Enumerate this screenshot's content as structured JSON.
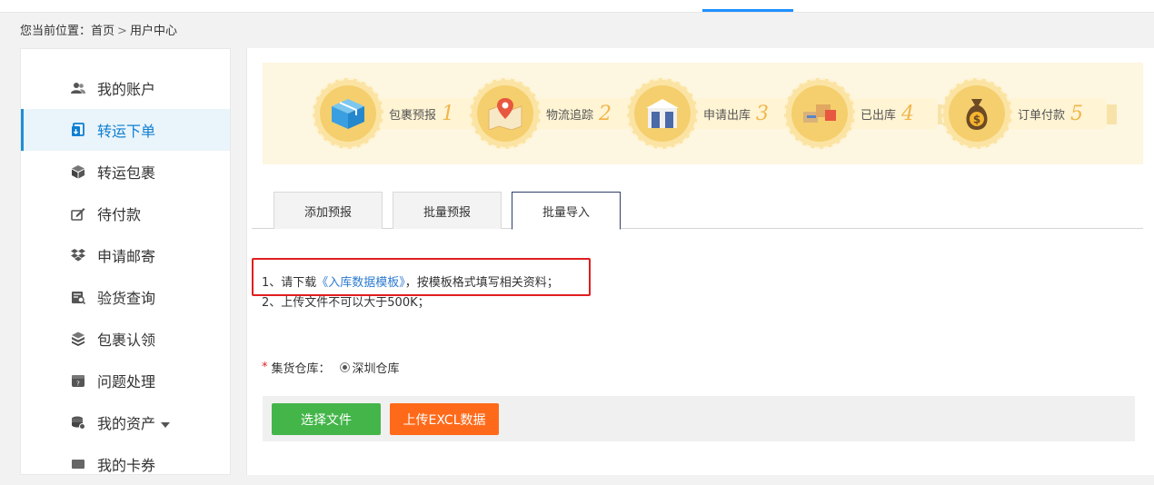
{
  "breadcrumb": {
    "prefix": "您当前位置：",
    "home": "首页",
    "sep": ">",
    "current": "用户中心"
  },
  "sidebar": {
    "items": [
      {
        "label": "我的账户",
        "icon": "users-icon"
      },
      {
        "label": "转运下单",
        "icon": "order-icon",
        "active": true
      },
      {
        "label": "转运包裹",
        "icon": "box-icon"
      },
      {
        "label": "待付款",
        "icon": "pen-icon"
      },
      {
        "label": "申请邮寄",
        "icon": "dropbox-icon"
      },
      {
        "label": "验货查询",
        "icon": "inspect-icon"
      },
      {
        "label": "包裹认领",
        "icon": "claim-icon"
      },
      {
        "label": "问题处理",
        "icon": "problem-icon"
      },
      {
        "label": "我的资产",
        "icon": "coins-icon",
        "has_caret": true
      },
      {
        "label": "我的卡券",
        "icon": "card-icon"
      }
    ]
  },
  "steps": [
    {
      "label": "包裹预报",
      "num": "1",
      "icon": "package-icon"
    },
    {
      "label": "物流追踪",
      "num": "2",
      "icon": "map-pin-icon"
    },
    {
      "label": "申请出库",
      "num": "3",
      "icon": "warehouse-icon"
    },
    {
      "label": "已出库",
      "num": "4",
      "icon": "boxes-icon"
    },
    {
      "label": "订单付款",
      "num": "5",
      "icon": "money-bag-icon"
    }
  ],
  "tabs": [
    {
      "label": "添加预报"
    },
    {
      "label": "批量预报"
    },
    {
      "label": "批量导入",
      "active": true
    }
  ],
  "notes": {
    "line1_prefix": "1、请下载",
    "line1_link": "《入库数据模板》",
    "line1_suffix": "，按模板格式填写相关资料；",
    "line2": "2、上传文件不可以大于500K；"
  },
  "warehouse": {
    "required_mark": "*",
    "label": "集货仓库：",
    "option": "深圳仓库"
  },
  "buttons": {
    "choose_file": "选择文件",
    "upload": "上传EXCL数据"
  },
  "colors": {
    "accent": "#1e8fd5",
    "green_button": "#44b549",
    "orange_button": "#ff6a1a",
    "highlight_box": "#e01e1e"
  }
}
